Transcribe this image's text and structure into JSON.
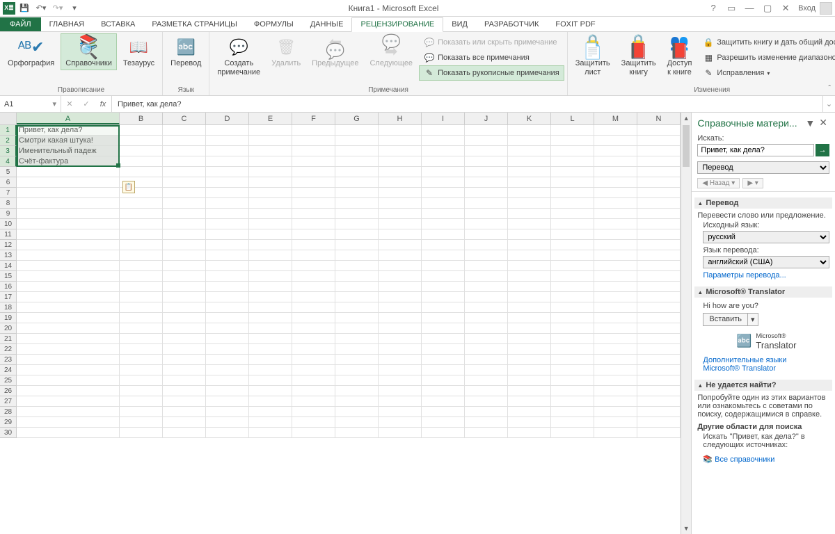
{
  "titlebar": {
    "title": "Книга1 - Microsoft Excel",
    "login": "Вход"
  },
  "tabs": {
    "file": "ФАЙЛ",
    "items": [
      "ГЛАВНАЯ",
      "ВСТАВКА",
      "РАЗМЕТКА СТРАНИЦЫ",
      "ФОРМУЛЫ",
      "ДАННЫЕ",
      "РЕЦЕНЗИРОВАНИЕ",
      "ВИД",
      "РАЗРАБОТЧИК",
      "FOXIT PDF"
    ],
    "active_index": 5
  },
  "ribbon": {
    "groups": {
      "proofing": {
        "label": "Правописание",
        "spelling": "Орфография",
        "research": "Справочники",
        "thesaurus": "Тезаурус"
      },
      "language": {
        "label": "Язык",
        "translate": "Перевод"
      },
      "comments": {
        "label": "Примечания",
        "new": "Создать\nпримечание",
        "delete": "Удалить",
        "prev": "Предыдущее",
        "next": "Следующее",
        "show_hide": "Показать или скрыть примечание",
        "show_all": "Показать все примечания",
        "show_ink": "Показать рукописные примечания"
      },
      "changes": {
        "label": "Изменения",
        "protect_sheet": "Защитить\nлист",
        "protect_book": "Защитить\nкнигу",
        "share_book": "Доступ\nк книге",
        "protect_share": "Защитить книгу и дать общий доступ",
        "allow_ranges": "Разрешить изменение диапазонов",
        "track": "Исправления"
      }
    }
  },
  "namebox": "A1",
  "formula": "Привет, как дела?",
  "columns": [
    "A",
    "B",
    "C",
    "D",
    "E",
    "F",
    "G",
    "H",
    "I",
    "J",
    "K",
    "L",
    "M",
    "N"
  ],
  "cells": {
    "a1": "Привет, как дела?",
    "a2": "Смотри какая штука!",
    "a3": "Именительный падеж",
    "a4": "Счёт-фактура"
  },
  "row_count": 30,
  "pane": {
    "title": "Справочные матери...",
    "search_label": "Искать:",
    "search_value": "Привет, как дела?",
    "service": "Перевод",
    "back": "Назад",
    "sec_translate": "Перевод",
    "translate_desc": "Перевести слово или предложение.",
    "src_label": "Исходный язык:",
    "src_value": "русский",
    "tgt_label": "Язык перевода:",
    "tgt_value": "английский (США)",
    "options": "Параметры перевода...",
    "ms_translator": "Microsoft® Translator",
    "result": "Hi how are you?",
    "insert": "Вставить",
    "translator_brand": "Translator",
    "translator_brand_pre": "Microsoft®",
    "more_langs": "Дополнительные языки",
    "ms_link": "Microsoft® Translator",
    "cant_find": "Не удается найти?",
    "cant_find_desc": "Попробуйте один из этих вариантов или ознакомьтесь с советами по поиску, содержащимися в справке.",
    "other_areas": "Другие области для поиска",
    "search_in": "Искать \"Привет, как дела?\" в следующих источниках:",
    "all_ref": "Все справочники"
  }
}
